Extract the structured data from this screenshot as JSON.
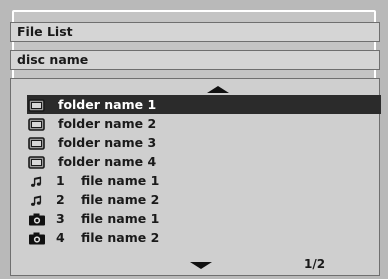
{
  "window": {
    "title": "File List",
    "disc_name": "disc name"
  },
  "list": {
    "scroll_up_icon": "triangle-up",
    "scroll_down_icon": "triangle-down",
    "page_indicator": "1/2",
    "selected_index": 0,
    "items": [
      {
        "type": "folder",
        "icon": "folder-icon",
        "number": "",
        "name": "folder name 1"
      },
      {
        "type": "folder",
        "icon": "folder-icon",
        "number": "",
        "name": "folder name 2"
      },
      {
        "type": "folder",
        "icon": "folder-icon",
        "number": "",
        "name": "folder name 3"
      },
      {
        "type": "folder",
        "icon": "folder-icon",
        "number": "",
        "name": "folder name 4"
      },
      {
        "type": "file",
        "icon": "music-note-icon",
        "number": "1",
        "name": "file name 1"
      },
      {
        "type": "file",
        "icon": "music-note-icon",
        "number": "2",
        "name": "file name 2"
      },
      {
        "type": "file",
        "icon": "camera-icon",
        "number": "3",
        "name": "file name 1"
      },
      {
        "type": "file",
        "icon": "camera-icon",
        "number": "4",
        "name": "file name 2"
      }
    ]
  },
  "colors": {
    "background": "#b9b9b9",
    "panel": "#cfcfcf",
    "selection": "#2b2b2b",
    "selection_text": "#ffffff",
    "text": "#1a1a1a"
  }
}
